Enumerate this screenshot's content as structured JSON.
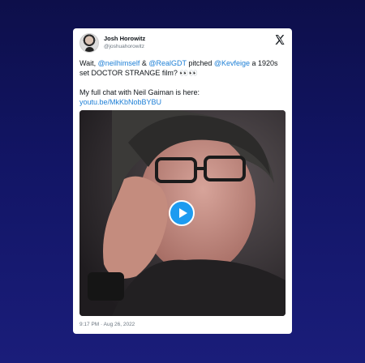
{
  "author": {
    "name": "Josh Horowitz",
    "handle": "@joshuahorowitz"
  },
  "icons": {
    "avatar": "profile-photo",
    "platform": "x-logo",
    "play": "play-icon"
  },
  "tweet": {
    "line1_pre": "Wait, ",
    "mention1": "@neilhimself",
    "line1_mid1": " & ",
    "mention2": "@RealGDT",
    "line1_mid2": " pitched ",
    "mention3": "@Kevfeige",
    "line1_post": " a 1920s set DOCTOR STRANGE film? 👀👀",
    "line2": "My full chat with Neil Gaiman is here:",
    "link": "youtu.be/MkKbNobBYBU"
  },
  "timestamp": "9:17 PM · Aug 26, 2022",
  "colors": {
    "background": "#121565",
    "card": "#ffffff",
    "link": "#1d7fd6",
    "play_button": "#1d9bf0"
  }
}
